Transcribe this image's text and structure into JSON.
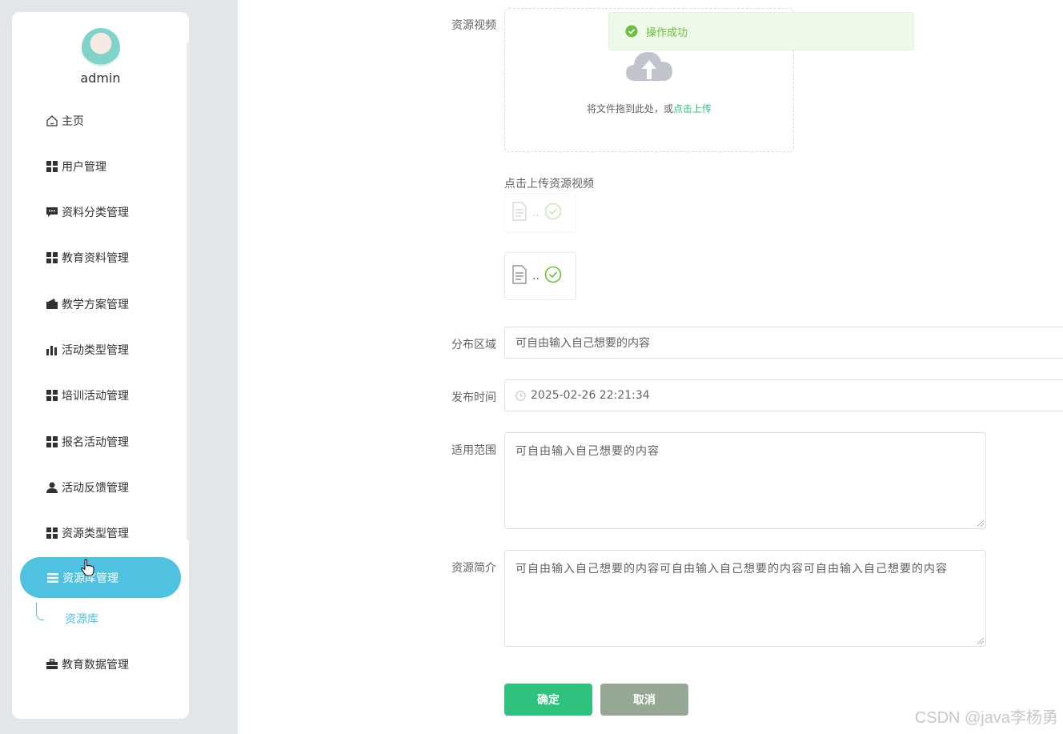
{
  "sidebar": {
    "username": "admin",
    "items": [
      {
        "label": "主页",
        "icon": "home-icon"
      },
      {
        "label": "用户管理",
        "icon": "grid-icon"
      },
      {
        "label": "资料分类管理",
        "icon": "chat-icon"
      },
      {
        "label": "教育资料管理",
        "icon": "grid-icon"
      },
      {
        "label": "教学方案管理",
        "icon": "wallet-icon"
      },
      {
        "label": "活动类型管理",
        "icon": "bar-chart-icon"
      },
      {
        "label": "培训活动管理",
        "icon": "grid-icon"
      },
      {
        "label": "报名活动管理",
        "icon": "grid-icon"
      },
      {
        "label": "活动反馈管理",
        "icon": "user-icon"
      },
      {
        "label": "资源类型管理",
        "icon": "grid-icon"
      },
      {
        "label": "资源库管理",
        "icon": "menu-icon",
        "active": true
      },
      {
        "label": "教育数据管理",
        "icon": "briefcase-icon"
      }
    ],
    "sub_item": "资源库"
  },
  "toast": {
    "text": "操作成功",
    "icon": "check-circle-icon"
  },
  "form": {
    "video_label": "资源视频",
    "upload_text": "将文件拖到此处，或",
    "upload_link": "点击上传",
    "upload_tip": "点击上传资源视频",
    "file_name": "..",
    "region_label": "分布区域",
    "region_value": "可自由输入自己想要的内容",
    "time_label": "发布时间",
    "time_value": "2025-02-26 22:21:34",
    "scope_label": "适用范围",
    "scope_value": "可自由输入自己想要的内容",
    "intro_label": "资源简介",
    "intro_value": "可自由输入自己想要的内容可自由输入自己想要的内容可自由输入自己想要的内容",
    "ok_label": "确定",
    "cancel_label": "取消"
  },
  "watermark": "CSDN @java李杨勇",
  "colors": {
    "accent": "#4ec2e0",
    "primary": "#2fc27f",
    "cancel": "#94a893",
    "success": "#67c23a"
  }
}
